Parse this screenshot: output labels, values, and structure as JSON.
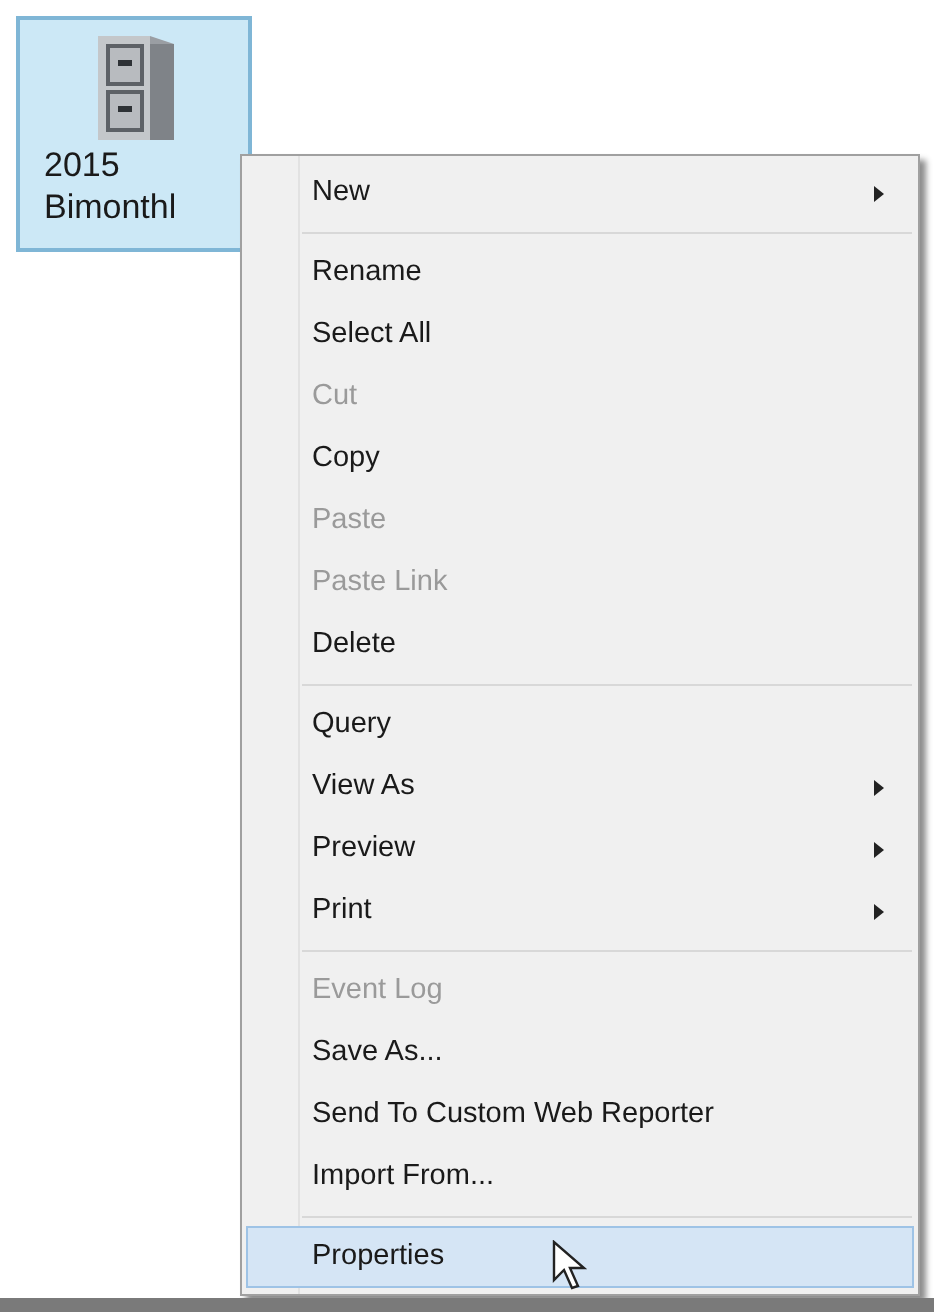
{
  "desktop_icon": {
    "label_lines": [
      "2015",
      "Bimonthl"
    ],
    "selected": true
  },
  "context_menu": {
    "items": [
      {
        "kind": "item",
        "label": "New",
        "disabled": false,
        "submenu": true,
        "selected": false
      },
      {
        "kind": "separator"
      },
      {
        "kind": "item",
        "label": "Rename",
        "disabled": false,
        "submenu": false,
        "selected": false
      },
      {
        "kind": "item",
        "label": "Select All",
        "disabled": false,
        "submenu": false,
        "selected": false
      },
      {
        "kind": "item",
        "label": "Cut",
        "disabled": true,
        "submenu": false,
        "selected": false
      },
      {
        "kind": "item",
        "label": "Copy",
        "disabled": false,
        "submenu": false,
        "selected": false
      },
      {
        "kind": "item",
        "label": "Paste",
        "disabled": true,
        "submenu": false,
        "selected": false
      },
      {
        "kind": "item",
        "label": "Paste Link",
        "disabled": true,
        "submenu": false,
        "selected": false
      },
      {
        "kind": "item",
        "label": "Delete",
        "disabled": false,
        "submenu": false,
        "selected": false
      },
      {
        "kind": "separator"
      },
      {
        "kind": "item",
        "label": "Query",
        "disabled": false,
        "submenu": false,
        "selected": false
      },
      {
        "kind": "item",
        "label": "View As",
        "disabled": false,
        "submenu": true,
        "selected": false
      },
      {
        "kind": "item",
        "label": "Preview",
        "disabled": false,
        "submenu": true,
        "selected": false
      },
      {
        "kind": "item",
        "label": "Print",
        "disabled": false,
        "submenu": true,
        "selected": false
      },
      {
        "kind": "separator"
      },
      {
        "kind": "item",
        "label": "Event Log",
        "disabled": true,
        "submenu": false,
        "selected": false
      },
      {
        "kind": "item",
        "label": "Save As...",
        "disabled": false,
        "submenu": false,
        "selected": false
      },
      {
        "kind": "item",
        "label": "Send To Custom Web Reporter",
        "disabled": false,
        "submenu": false,
        "selected": false
      },
      {
        "kind": "item",
        "label": "Import From...",
        "disabled": false,
        "submenu": false,
        "selected": false
      },
      {
        "kind": "separator"
      },
      {
        "kind": "item",
        "label": "Properties",
        "disabled": false,
        "submenu": false,
        "selected": true
      }
    ]
  }
}
